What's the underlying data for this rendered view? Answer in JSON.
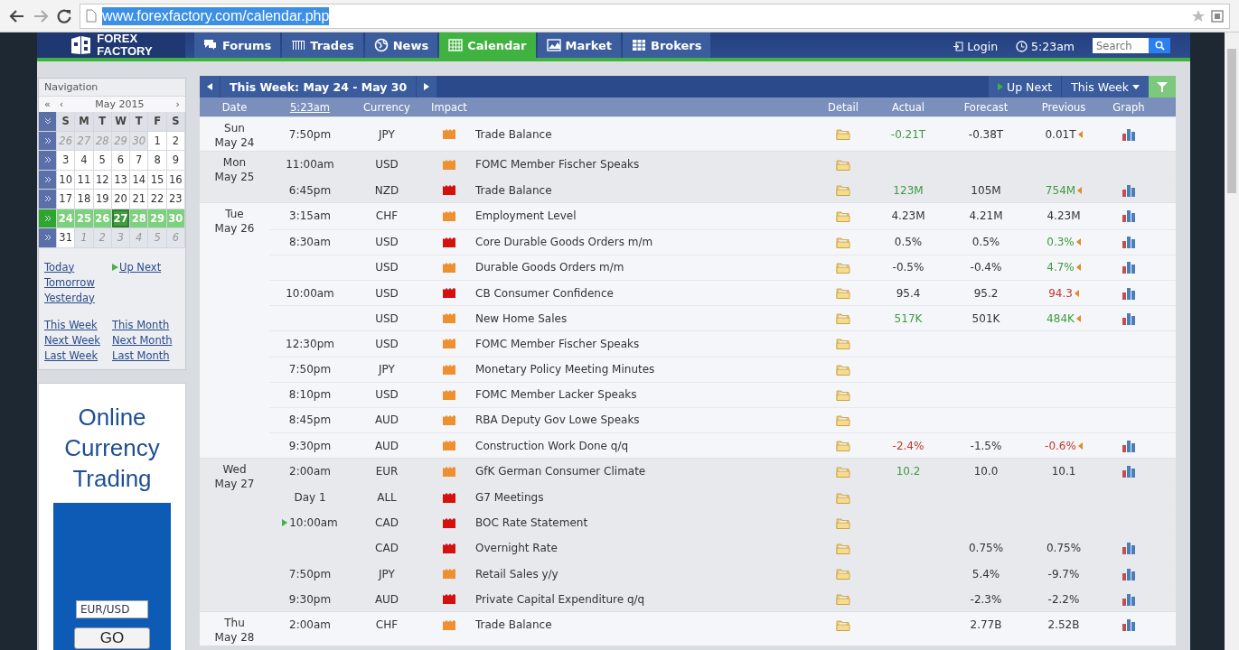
{
  "browser": {
    "url": "www.forexfactory.com/calendar.php",
    "url_selected": true
  },
  "site": {
    "logo_lines": [
      "FOREX",
      "FACTORY"
    ],
    "nav": [
      {
        "label": "Forums",
        "selected": false
      },
      {
        "label": "Trades",
        "selected": false
      },
      {
        "label": "News",
        "selected": false
      },
      {
        "label": "Calendar",
        "selected": true
      },
      {
        "label": "Market",
        "selected": false
      },
      {
        "label": "Brokers",
        "selected": false
      }
    ],
    "login": "Login",
    "time": "5:23am",
    "search": {
      "placeholder": "Search"
    }
  },
  "sidebar": {
    "title": "Navigation",
    "calendar": {
      "prev_year": "«",
      "prev_month": "‹",
      "month": "May 2015",
      "next_month": "›",
      "weekdays": [
        "S",
        "M",
        "T",
        "W",
        "T",
        "F",
        "S"
      ],
      "weeks": [
        {
          "selected": false,
          "days": [
            {
              "text": "26",
              "other_month": true,
              "today": false
            },
            {
              "text": "27",
              "other_month": true,
              "today": false
            },
            {
              "text": "28",
              "other_month": true,
              "today": false
            },
            {
              "text": "29",
              "other_month": true,
              "today": false
            },
            {
              "text": "30",
              "other_month": true,
              "today": false
            },
            {
              "text": "1",
              "other_month": false,
              "today": false
            },
            {
              "text": "2",
              "other_month": false,
              "today": false
            }
          ]
        },
        {
          "selected": false,
          "days": [
            {
              "text": "3",
              "other_month": false,
              "today": false
            },
            {
              "text": "4",
              "other_month": false,
              "today": false
            },
            {
              "text": "5",
              "other_month": false,
              "today": false
            },
            {
              "text": "6",
              "other_month": false,
              "today": false
            },
            {
              "text": "7",
              "other_month": false,
              "today": false
            },
            {
              "text": "8",
              "other_month": false,
              "today": false
            },
            {
              "text": "9",
              "other_month": false,
              "today": false
            }
          ]
        },
        {
          "selected": false,
          "days": [
            {
              "text": "10",
              "other_month": false,
              "today": false
            },
            {
              "text": "11",
              "other_month": false,
              "today": false
            },
            {
              "text": "12",
              "other_month": false,
              "today": false
            },
            {
              "text": "13",
              "other_month": false,
              "today": false
            },
            {
              "text": "14",
              "other_month": false,
              "today": false
            },
            {
              "text": "15",
              "other_month": false,
              "today": false
            },
            {
              "text": "16",
              "other_month": false,
              "today": false
            }
          ]
        },
        {
          "selected": false,
          "days": [
            {
              "text": "17",
              "other_month": false,
              "today": false
            },
            {
              "text": "18",
              "other_month": false,
              "today": false
            },
            {
              "text": "19",
              "other_month": false,
              "today": false
            },
            {
              "text": "20",
              "other_month": false,
              "today": false
            },
            {
              "text": "21",
              "other_month": false,
              "today": false
            },
            {
              "text": "22",
              "other_month": false,
              "today": false
            },
            {
              "text": "23",
              "other_month": false,
              "today": false
            }
          ]
        },
        {
          "selected": true,
          "days": [
            {
              "text": "24",
              "other_month": false,
              "today": false
            },
            {
              "text": "25",
              "other_month": false,
              "today": false
            },
            {
              "text": "26",
              "other_month": false,
              "today": false
            },
            {
              "text": "27",
              "other_month": false,
              "today": true
            },
            {
              "text": "28",
              "other_month": false,
              "today": false
            },
            {
              "text": "29",
              "other_month": false,
              "today": false
            },
            {
              "text": "30",
              "other_month": false,
              "today": false
            }
          ]
        },
        {
          "selected": false,
          "days": [
            {
              "text": "31",
              "other_month": false,
              "today": false
            },
            {
              "text": "1",
              "other_month": true,
              "today": false
            },
            {
              "text": "2",
              "other_month": true,
              "today": false
            },
            {
              "text": "3",
              "other_month": true,
              "today": false
            },
            {
              "text": "4",
              "other_month": true,
              "today": false
            },
            {
              "text": "5",
              "other_month": true,
              "today": false
            },
            {
              "text": "6",
              "other_month": true,
              "today": false
            }
          ]
        }
      ]
    },
    "quick_links_left": [
      {
        "label": "Today",
        "up_next": false
      },
      {
        "label": "Tomorrow",
        "up_next": false
      },
      {
        "label": "Yesterday",
        "up_next": false
      }
    ],
    "quick_links_right": [
      {
        "label": "Up Next",
        "up_next": true
      }
    ],
    "range_links": [
      "This Week",
      "This Month",
      "Next Week",
      "Next Month",
      "Last Week",
      "Last Month"
    ]
  },
  "ad": {
    "heading": "Online Currency Trading",
    "pair": "EUR/USD",
    "button": "GO"
  },
  "calendar": {
    "week_label": "This Week: May 24 - May 30",
    "up_next": "Up Next",
    "range": "This Week",
    "columns": [
      "Date",
      "5:23am",
      "Currency",
      "Impact",
      "Detail",
      "Actual",
      "Forecast",
      "Previous",
      "Graph"
    ],
    "days": [
      {
        "day": "Sun",
        "date": "May 24",
        "events": [
          {
            "time": "7:50pm",
            "currency": "JPY",
            "color": "#ef9030",
            "title": "Trade Balance",
            "up_next": false,
            "actual": {
              "text": "-0.21T",
              "color": "#3f9a3f"
            },
            "forecast": "-0.38T",
            "previous": {
              "text": "0.01T",
              "color": "#333333",
              "revised": true
            },
            "graph": true
          }
        ]
      },
      {
        "day": "Mon",
        "date": "May 25",
        "events": [
          {
            "time": "11:00am",
            "currency": "USD",
            "color": "#ef9030",
            "title": "FOMC Member Fischer Speaks",
            "up_next": false,
            "graph": false
          },
          {
            "time": "6:45pm",
            "currency": "NZD",
            "color": "#d4110f",
            "title": "Trade Balance",
            "up_next": false,
            "actual": {
              "text": "123M",
              "color": "#3f9a3f"
            },
            "forecast": "105M",
            "previous": {
              "text": "754M",
              "color": "#3f9a3f",
              "revised": true
            },
            "graph": true
          }
        ]
      },
      {
        "day": "Tue",
        "date": "May 26",
        "events": [
          {
            "time": "3:15am",
            "currency": "CHF",
            "color": "#ef9030",
            "title": "Employment Level",
            "up_next": false,
            "actual": {
              "text": "4.23M",
              "color": "#333333"
            },
            "forecast": "4.21M",
            "previous": {
              "text": "4.23M",
              "color": "#333333",
              "revised": false
            },
            "graph": true
          },
          {
            "time": "8:30am",
            "currency": "USD",
            "color": "#d4110f",
            "title": "Core Durable Goods Orders m/m",
            "up_next": false,
            "actual": {
              "text": "0.5%",
              "color": "#333333"
            },
            "forecast": "0.5%",
            "previous": {
              "text": "0.3%",
              "color": "#3f9a3f",
              "revised": true
            },
            "graph": true
          },
          {
            "currency": "USD",
            "color": "#ef9030",
            "title": "Durable Goods Orders m/m",
            "up_next": false,
            "actual": {
              "text": "-0.5%",
              "color": "#333333"
            },
            "forecast": "-0.4%",
            "previous": {
              "text": "4.7%",
              "color": "#3f9a3f",
              "revised": true
            },
            "graph": true
          },
          {
            "time": "10:00am",
            "currency": "USD",
            "color": "#d4110f",
            "title": "CB Consumer Confidence",
            "up_next": false,
            "actual": {
              "text": "95.4",
              "color": "#333333"
            },
            "forecast": "95.2",
            "previous": {
              "text": "94.3",
              "color": "#c0392b",
              "revised": true
            },
            "graph": true
          },
          {
            "currency": "USD",
            "color": "#ef9030",
            "title": "New Home Sales",
            "up_next": false,
            "actual": {
              "text": "517K",
              "color": "#3f9a3f"
            },
            "forecast": "501K",
            "previous": {
              "text": "484K",
              "color": "#3f9a3f",
              "revised": true
            },
            "graph": true
          },
          {
            "time": "12:30pm",
            "currency": "USD",
            "color": "#ef9030",
            "title": "FOMC Member Fischer Speaks",
            "up_next": false,
            "graph": false
          },
          {
            "time": "7:50pm",
            "currency": "JPY",
            "color": "#ef9030",
            "title": "Monetary Policy Meeting Minutes",
            "up_next": false,
            "graph": false
          },
          {
            "time": "8:10pm",
            "currency": "USD",
            "color": "#ef9030",
            "title": "FOMC Member Lacker Speaks",
            "up_next": false,
            "graph": false
          },
          {
            "time": "8:45pm",
            "currency": "AUD",
            "color": "#ef9030",
            "title": "RBA Deputy Gov Lowe Speaks",
            "up_next": false,
            "graph": false
          },
          {
            "time": "9:30pm",
            "currency": "AUD",
            "color": "#ef9030",
            "title": "Construction Work Done q/q",
            "up_next": false,
            "actual": {
              "text": "-2.4%",
              "color": "#c0392b"
            },
            "forecast": "-1.5%",
            "previous": {
              "text": "-0.6%",
              "color": "#c0392b",
              "revised": true
            },
            "graph": true
          }
        ]
      },
      {
        "day": "Wed",
        "date": "May 27",
        "events": [
          {
            "time": "2:00am",
            "currency": "EUR",
            "color": "#ef9030",
            "title": "GfK German Consumer Climate",
            "up_next": false,
            "actual": {
              "text": "10.2",
              "color": "#3f9a3f"
            },
            "forecast": "10.0",
            "previous": {
              "text": "10.1",
              "color": "#333333",
              "revised": false
            },
            "graph": true
          },
          {
            "time": "Day 1",
            "currency": "ALL",
            "color": "#d4110f",
            "title": "G7 Meetings",
            "up_next": false,
            "graph": false
          },
          {
            "time": "10:00am",
            "currency": "CAD",
            "color": "#d4110f",
            "title": "BOC Rate Statement",
            "up_next": true,
            "graph": false
          },
          {
            "currency": "CAD",
            "color": "#d4110f",
            "title": "Overnight Rate",
            "up_next": false,
            "forecast": "0.75%",
            "previous": {
              "text": "0.75%",
              "color": "#333333",
              "revised": false
            },
            "graph": true
          },
          {
            "time": "7:50pm",
            "currency": "JPY",
            "color": "#ef9030",
            "title": "Retail Sales y/y",
            "up_next": false,
            "forecast": "5.4%",
            "previous": {
              "text": "-9.7%",
              "color": "#333333",
              "revised": false
            },
            "graph": true
          },
          {
            "time": "9:30pm",
            "currency": "AUD",
            "color": "#d4110f",
            "title": "Private Capital Expenditure q/q",
            "up_next": false,
            "forecast": "-2.3%",
            "previous": {
              "text": "-2.2%",
              "color": "#333333",
              "revised": false
            },
            "graph": true
          }
        ]
      },
      {
        "day": "Thu",
        "date": "May 28",
        "events": [
          {
            "time": "2:00am",
            "currency": "CHF",
            "color": "#ef9030",
            "title": "Trade Balance",
            "up_next": false,
            "forecast": "2.77B",
            "previous": {
              "text": "2.52B",
              "color": "#333333",
              "revised": false
            },
            "graph": true
          }
        ]
      }
    ]
  }
}
